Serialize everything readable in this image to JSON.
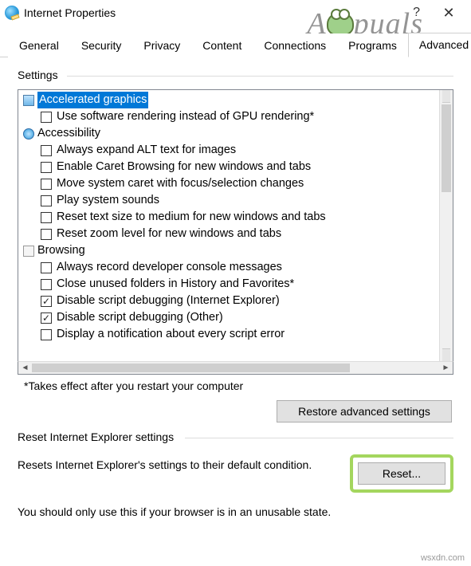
{
  "window": {
    "title": "Internet Properties",
    "help": "?",
    "close": "✕"
  },
  "watermark": {
    "left": "A",
    "right": "puals"
  },
  "tabs": [
    "General",
    "Security",
    "Privacy",
    "Content",
    "Connections",
    "Programs",
    "Advanced"
  ],
  "active_tab": "Advanced",
  "settings": {
    "label": "Settings",
    "tree": [
      {
        "type": "cat",
        "icon": "screen",
        "label": "Accelerated graphics",
        "selected": true
      },
      {
        "type": "chk",
        "checked": false,
        "label": "Use software rendering instead of GPU rendering*"
      },
      {
        "type": "cat",
        "icon": "access",
        "label": "Accessibility"
      },
      {
        "type": "chk",
        "checked": false,
        "label": "Always expand ALT text for images"
      },
      {
        "type": "chk",
        "checked": false,
        "label": "Enable Caret Browsing for new windows and tabs"
      },
      {
        "type": "chk",
        "checked": false,
        "label": "Move system caret with focus/selection changes"
      },
      {
        "type": "chk",
        "checked": false,
        "label": "Play system sounds"
      },
      {
        "type": "chk",
        "checked": false,
        "label": "Reset text size to medium for new windows and tabs"
      },
      {
        "type": "chk",
        "checked": false,
        "label": "Reset zoom level for new windows and tabs"
      },
      {
        "type": "cat",
        "icon": "browse",
        "label": "Browsing"
      },
      {
        "type": "chk",
        "checked": false,
        "label": "Always record developer console messages"
      },
      {
        "type": "chk",
        "checked": false,
        "label": "Close unused folders in History and Favorites*"
      },
      {
        "type": "chk",
        "checked": true,
        "label": "Disable script debugging (Internet Explorer)"
      },
      {
        "type": "chk",
        "checked": true,
        "label": "Disable script debugging (Other)"
      },
      {
        "type": "chk",
        "checked": false,
        "label": "Display a notification about every script error"
      }
    ],
    "note": "*Takes effect after you restart your computer",
    "restore_btn": "Restore advanced settings"
  },
  "reset": {
    "label": "Reset Internet Explorer settings",
    "desc": "Resets Internet Explorer's settings to their default condition.",
    "btn": "Reset...",
    "warn": "You should only use this if your browser is in an unusable state."
  },
  "footer": "wsxdn.com"
}
